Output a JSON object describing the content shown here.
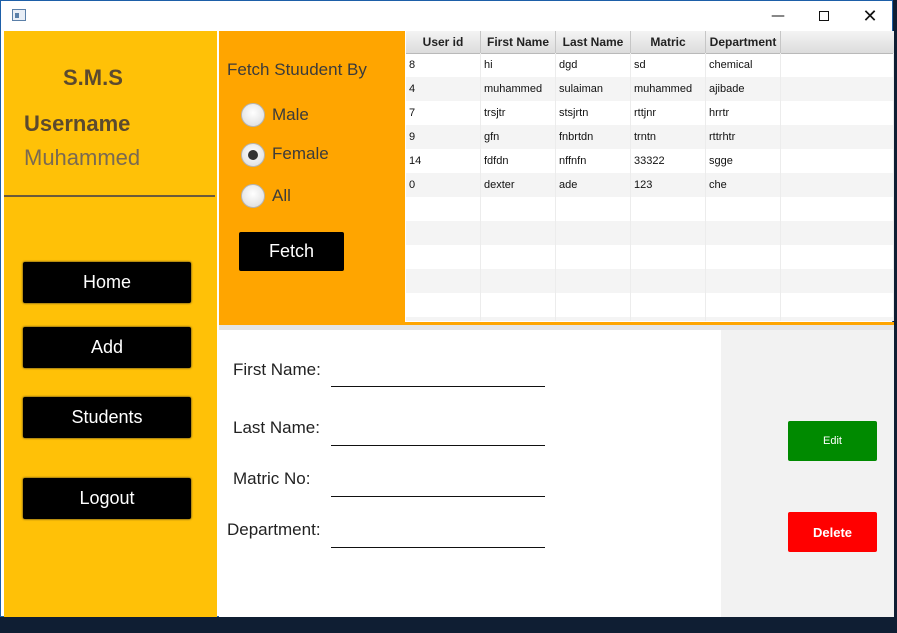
{
  "window": {
    "controls": {
      "minimize_icon": "minimize-icon",
      "maximize_icon": "maximize-icon",
      "close_icon": "close-icon"
    }
  },
  "sidebar": {
    "app_title": "S.M.S",
    "username_label": "Username",
    "username_value": "Muhammed",
    "nav": [
      {
        "label": "Home"
      },
      {
        "label": "Add"
      },
      {
        "label": "Students"
      },
      {
        "label": "Logout"
      }
    ]
  },
  "filter": {
    "title": "Fetch Stuudent By",
    "options": [
      {
        "label": "Male",
        "checked": false
      },
      {
        "label": "Female",
        "checked": true
      },
      {
        "label": "All",
        "checked": false
      }
    ],
    "fetch_label": "Fetch"
  },
  "table": {
    "columns": [
      "User id",
      "First Name",
      "Last Name",
      "Matric",
      "Department"
    ],
    "rows": [
      [
        "8",
        "hi",
        "dgd",
        "sd",
        "chemical"
      ],
      [
        "4",
        "muhammed",
        "sulaiman",
        "muhammed",
        "ajibade"
      ],
      [
        "7",
        "trsjtr",
        "stsjrtn",
        "rttjnr",
        "hrrtr"
      ],
      [
        "9",
        "gfn",
        "fnbrtdn",
        "trntn",
        "rttrhtr"
      ],
      [
        "14",
        "fdfdn",
        "nffnfn",
        "33322",
        "sgge"
      ],
      [
        "0",
        "dexter",
        "ade",
        "123",
        "che"
      ]
    ]
  },
  "form": {
    "first_name_label": "First Name:",
    "last_name_label": "Last Name:",
    "matric_label": "Matric No:",
    "department_label": "Department:",
    "first_name_value": "",
    "last_name_value": "",
    "matric_value": "",
    "department_value": ""
  },
  "actions": {
    "edit_label": "Edit",
    "delete_label": "Delete"
  },
  "colors": {
    "sidebar": "#ffc107",
    "filter_panel": "#ffa500",
    "edit": "#008a00",
    "delete": "#ff0000"
  }
}
